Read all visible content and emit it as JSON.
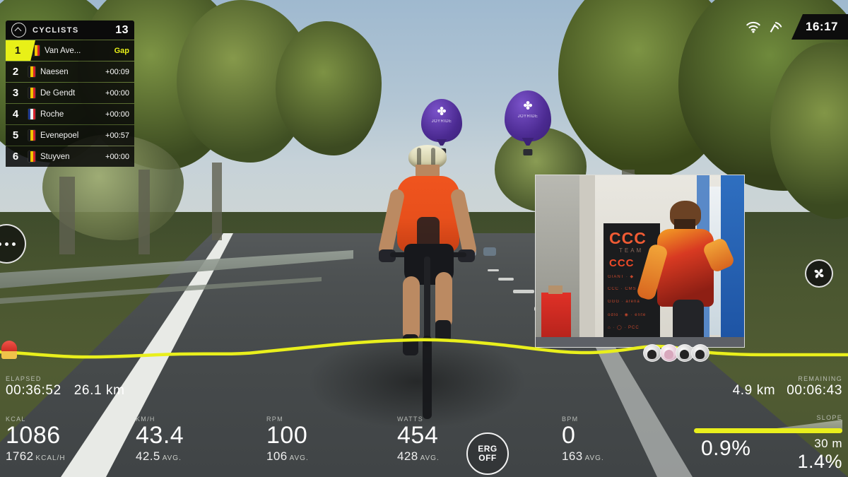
{
  "leaderboard": {
    "title": "CYCLISTS",
    "count": "13",
    "collapse_icon": "chevron-up-icon",
    "rows": [
      {
        "pos": "1",
        "name": "Van Ave...",
        "gap": "Gap",
        "flag": "be",
        "leader": true
      },
      {
        "pos": "2",
        "name": "Naesen",
        "gap": "+00:09",
        "flag": "be",
        "leader": false
      },
      {
        "pos": "3",
        "name": "De Gendt",
        "gap": "+00:00",
        "flag": "be",
        "leader": false
      },
      {
        "pos": "4",
        "name": "Roche",
        "gap": "+00:00",
        "flag": "fr",
        "leader": false
      },
      {
        "pos": "5",
        "name": "Evenepoel",
        "gap": "+00:57",
        "flag": "be",
        "leader": false
      },
      {
        "pos": "6",
        "name": "Stuyven",
        "gap": "+00:00",
        "flag": "be",
        "leader": false
      }
    ]
  },
  "hud": {
    "wifi_icon": "wifi-icon",
    "signal_icon": "signal-strength-icon",
    "clock": "16:17"
  },
  "more_button": {
    "icon": "more-options-icon",
    "label": "..."
  },
  "fan_button": {
    "icon": "fan-icon"
  },
  "elapsed": {
    "label": "ELAPSED",
    "time": "00:36:52",
    "distance": "26.1 km"
  },
  "remaining": {
    "label": "REMAINING",
    "distance": "4.9 km",
    "time": "00:06:43"
  },
  "metrics": [
    {
      "label": "KCAL",
      "value": "1086",
      "sub_value": "1762",
      "sub_unit": "KCAL/H"
    },
    {
      "label": "KM/H",
      "value": "43.4",
      "sub_value": "42.5",
      "sub_unit": "AVG."
    },
    {
      "label": "RPM",
      "value": "100",
      "sub_value": "106",
      "sub_unit": "AVG."
    },
    {
      "label": "WATTS",
      "value": "454",
      "sub_value": "428",
      "sub_unit": "AVG."
    },
    {
      "label": "BPM",
      "value": "0",
      "sub_value": "163",
      "sub_unit": "AVG."
    }
  ],
  "erg_button": {
    "line1": "ERG",
    "line2": "OFF"
  },
  "slope": {
    "label": "SLOPE",
    "current_grade": "0.9%",
    "ahead_distance": "30 m",
    "ahead_grade": "1.4%"
  },
  "pip": {
    "banner_main": "CCC",
    "banner_team": "TEAM",
    "banner_sub": "CCC",
    "sponsor_rows": [
      "GIANT  ·  ◆",
      "CCC  ·  CMS",
      "GGG  ·  arena",
      "odlo  ·  ◉  ·  elite",
      "⌂  ·  ◯  ·  PCC"
    ]
  },
  "balloons": [
    {
      "logo": "✤",
      "text": "JOYRIDE"
    },
    {
      "logo": "✤",
      "text": "JOYRIDE"
    }
  ],
  "colors": {
    "accent_yellow": "#e8f018",
    "jersey_orange": "#f0541e",
    "profile_line": "#e9ef1c",
    "panel_black": "#0b0b0b"
  }
}
